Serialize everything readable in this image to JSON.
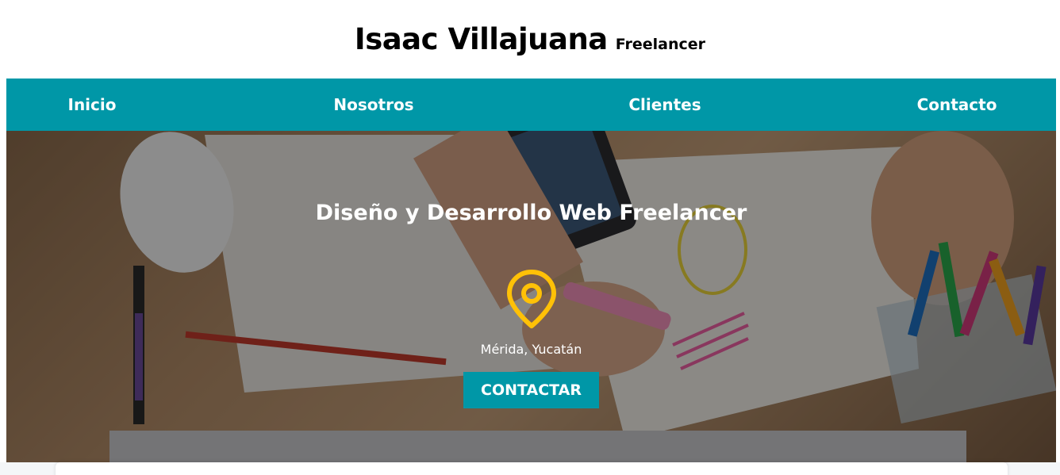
{
  "header": {
    "brand_name": "Isaac Villajuana",
    "brand_tagline": "Freelancer"
  },
  "nav": {
    "items": [
      {
        "label": "Inicio"
      },
      {
        "label": "Nosotros"
      },
      {
        "label": "Clientes"
      },
      {
        "label": "Contacto"
      }
    ]
  },
  "hero": {
    "title": "Diseño y Desarrollo Web Freelancer",
    "location": "Mérida, Yucatán",
    "location_icon": "map-pin-icon",
    "cta_label": "CONTACTAR"
  },
  "colors": {
    "accent": "#0097a7",
    "pin": "#ffc107",
    "text_light": "#ffffff"
  }
}
